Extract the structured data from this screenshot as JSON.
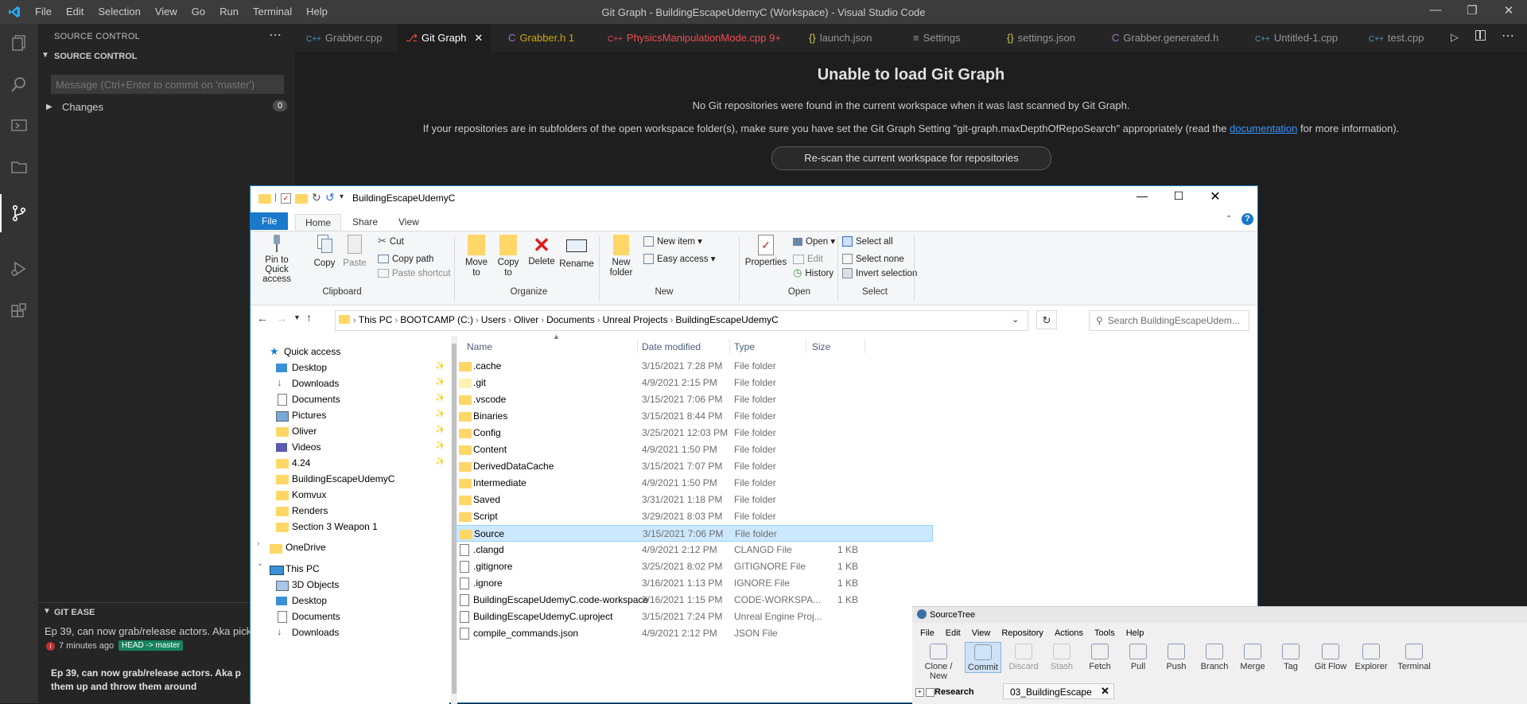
{
  "vscode": {
    "window_title": "Git Graph - BuildingEscapeUdemyC (Workspace) - Visual Studio Code",
    "menu": [
      "File",
      "Edit",
      "Selection",
      "View",
      "Go",
      "Run",
      "Terminal",
      "Help"
    ],
    "sidebar": {
      "title": "SOURCE CONTROL",
      "section": "SOURCE CONTROL",
      "message_placeholder": "Message (Ctrl+Enter to commit on 'master')",
      "changes_label": "Changes",
      "changes_count": "0"
    },
    "tabs": [
      {
        "label": "Grabber.cpp",
        "icon": "C++",
        "color": "#969696"
      },
      {
        "label": "Git Graph",
        "active": true
      },
      {
        "label": "Grabber.h 1",
        "icon": "C",
        "color": "#cca700"
      },
      {
        "label": "PhysicsManipulationMode.cpp 9+",
        "icon": "C++",
        "color": "#f14c4c"
      },
      {
        "label": "launch.json",
        "icon": "{}",
        "color": "#969696"
      },
      {
        "label": "Settings",
        "icon": "≡",
        "color": "#969696"
      },
      {
        "label": "settings.json",
        "icon": "{}",
        "color": "#969696"
      },
      {
        "label": "Grabber.generated.h",
        "icon": "C",
        "color": "#969696"
      },
      {
        "label": "Untitled-1.cpp",
        "icon": "C++",
        "color": "#969696"
      },
      {
        "label": "test.cpp",
        "icon": "C++",
        "color": "#969696"
      }
    ],
    "git_graph": {
      "title": "Unable to load Git Graph",
      "line1": "No Git repositories were found in the current workspace when it was last scanned by Git Graph.",
      "line2_pre": "If your repositories are in subfolders of the open workspace folder(s), make sure you have set the Git Graph Setting \"git-graph.maxDepthOfRepoSearch\" appropriately (read the ",
      "line2_link": "documentation",
      "line2_post": " for more information).",
      "rescan_button": "Re-scan the current workspace for repositories"
    },
    "git_ease": {
      "header": "GIT EASE",
      "commit_msg": "Ep 39, can now grab/release actors. Aka pick",
      "time": "7 minutes ago",
      "head_tag": "HEAD -> master",
      "detail_line1": "Ep 39, can now grab/release actors. Aka p",
      "detail_line2": "them up and throw them around"
    }
  },
  "explorer": {
    "title": "BuildingEscapeUdemyC",
    "ribbon_tabs": [
      "File",
      "Home",
      "Share",
      "View"
    ],
    "clipboard": {
      "pin": "Pin to Quick access",
      "copy": "Copy",
      "paste": "Paste",
      "cut": "Cut",
      "copy_path": "Copy path",
      "paste_shortcut": "Paste shortcut",
      "group": "Clipboard"
    },
    "organize": {
      "move_to": "Move to",
      "copy_to": "Copy to",
      "delete": "Delete",
      "rename": "Rename",
      "group": "Organize"
    },
    "new": {
      "new_folder": "New folder",
      "new_item": "New item",
      "easy_access": "Easy access",
      "group": "New"
    },
    "open": {
      "properties": "Properties",
      "open": "Open",
      "edit": "Edit",
      "history": "History",
      "group": "Open"
    },
    "select": {
      "select_all": "Select all",
      "select_none": "Select none",
      "invert": "Invert selection",
      "group": "Select"
    },
    "breadcrumb": [
      "This PC",
      "BOOTCAMP (C:)",
      "Users",
      "Oliver",
      "Documents",
      "Unreal Projects",
      "BuildingEscapeUdemyC"
    ],
    "search_placeholder": "Search BuildingEscapeUdem...",
    "nav": {
      "quick_access": "Quick access",
      "pinned": [
        "Desktop",
        "Downloads",
        "Documents",
        "Pictures",
        "Oliver",
        "Videos",
        "4.24"
      ],
      "folders": [
        "BuildingEscapeUdemyC",
        "Komvux",
        "Renders",
        "Section 3 Weapon 1"
      ],
      "onedrive": "OneDrive",
      "this_pc": "This PC",
      "pc_items": [
        "3D Objects",
        "Desktop",
        "Documents",
        "Downloads"
      ]
    },
    "columns": [
      "Name",
      "Date modified",
      "Type",
      "Size"
    ],
    "files": [
      {
        "name": ".cache",
        "date": "3/15/2021 7:28 PM",
        "type": "File folder",
        "size": "",
        "kind": "folder"
      },
      {
        "name": ".git",
        "date": "4/9/2021 2:15 PM",
        "type": "File folder",
        "size": "",
        "kind": "folder-light"
      },
      {
        "name": ".vscode",
        "date": "3/15/2021 7:06 PM",
        "type": "File folder",
        "size": "",
        "kind": "folder"
      },
      {
        "name": "Binaries",
        "date": "3/15/2021 8:44 PM",
        "type": "File folder",
        "size": "",
        "kind": "folder"
      },
      {
        "name": "Config",
        "date": "3/25/2021 12:03 PM",
        "type": "File folder",
        "size": "",
        "kind": "folder"
      },
      {
        "name": "Content",
        "date": "4/9/2021 1:50 PM",
        "type": "File folder",
        "size": "",
        "kind": "folder"
      },
      {
        "name": "DerivedDataCache",
        "date": "3/15/2021 7:07 PM",
        "type": "File folder",
        "size": "",
        "kind": "folder"
      },
      {
        "name": "Intermediate",
        "date": "4/9/2021 1:50 PM",
        "type": "File folder",
        "size": "",
        "kind": "folder"
      },
      {
        "name": "Saved",
        "date": "3/31/2021 1:18 PM",
        "type": "File folder",
        "size": "",
        "kind": "folder"
      },
      {
        "name": "Script",
        "date": "3/29/2021 8:03 PM",
        "type": "File folder",
        "size": "",
        "kind": "folder"
      },
      {
        "name": "Source",
        "date": "3/15/2021 7:06 PM",
        "type": "File folder",
        "size": "",
        "kind": "folder",
        "selected": true
      },
      {
        "name": ".clangd",
        "date": "4/9/2021 2:12 PM",
        "type": "CLANGD File",
        "size": "1 KB",
        "kind": "file"
      },
      {
        "name": ".gitignore",
        "date": "3/25/2021 8:02 PM",
        "type": "GITIGNORE File",
        "size": "1 KB",
        "kind": "file"
      },
      {
        "name": ".ignore",
        "date": "3/16/2021 1:13 PM",
        "type": "IGNORE File",
        "size": "1 KB",
        "kind": "file"
      },
      {
        "name": "BuildingEscapeUdemyC.code-workspace",
        "date": "3/16/2021 1:15 PM",
        "type": "CODE-WORKSPA...",
        "size": "1 KB",
        "kind": "file"
      },
      {
        "name": "BuildingEscapeUdemyC.uproject",
        "date": "3/15/2021 7:24 PM",
        "type": "Unreal Engine Proj...",
        "size": "",
        "kind": "file"
      },
      {
        "name": "compile_commands.json",
        "date": "4/9/2021 2:12 PM",
        "type": "JSON File",
        "size": "",
        "kind": "file"
      }
    ]
  },
  "sourcetree": {
    "title": "SourceTree",
    "menu": [
      "File",
      "Edit",
      "View",
      "Repository",
      "Actions",
      "Tools",
      "Help"
    ],
    "toolbar": [
      {
        "label": "Clone / New",
        "enabled": true
      },
      {
        "label": "Commit",
        "enabled": true
      },
      {
        "label": "Discard",
        "enabled": false
      },
      {
        "label": "Stash",
        "enabled": false
      },
      {
        "label": "Fetch",
        "enabled": true
      },
      {
        "label": "Pull",
        "enabled": true
      },
      {
        "label": "Push",
        "enabled": true
      },
      {
        "label": "Branch",
        "enabled": true
      },
      {
        "label": "Merge",
        "enabled": true
      },
      {
        "label": "Tag",
        "enabled": true
      },
      {
        "label": "Git Flow",
        "enabled": true
      },
      {
        "label": "Explorer",
        "enabled": true
      },
      {
        "label": "Terminal",
        "enabled": true
      }
    ],
    "tree_item": "Research",
    "repo_tab": "03_BuildingEscape"
  }
}
